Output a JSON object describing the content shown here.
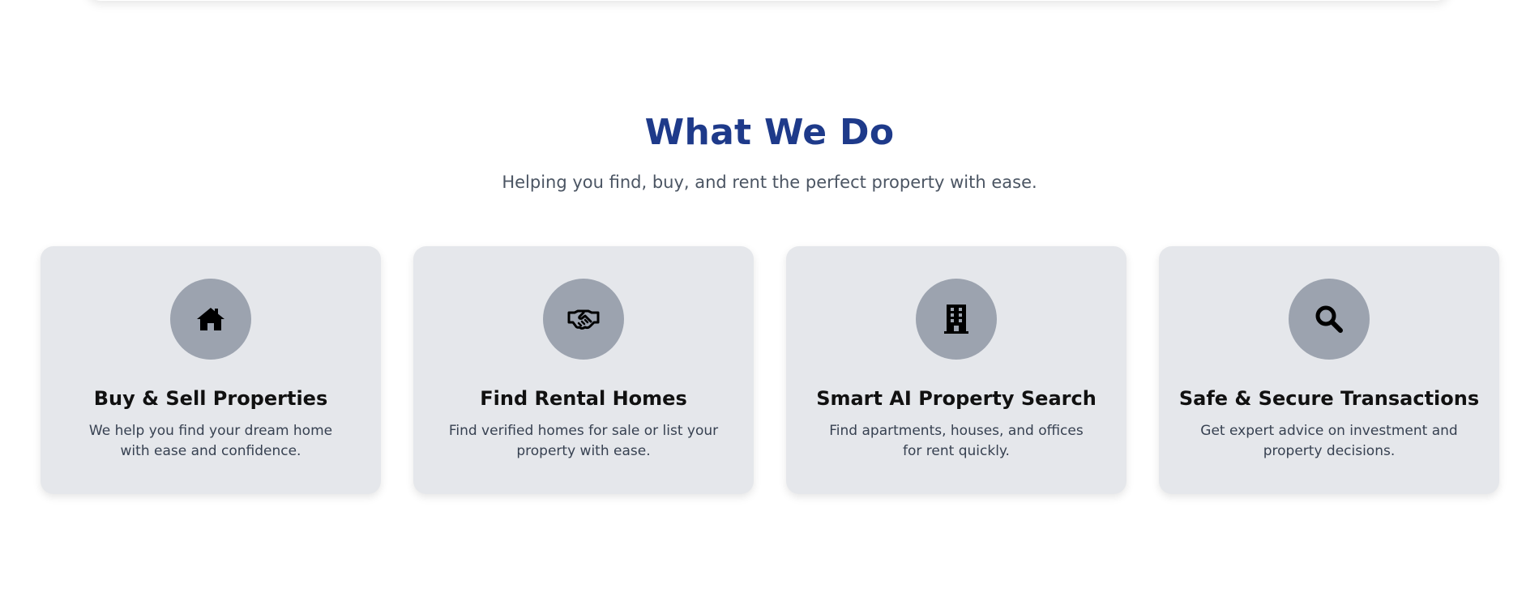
{
  "section": {
    "title": "What We Do",
    "subtitle": "Helping you find, buy, and rent the perfect property with ease."
  },
  "cards": [
    {
      "icon": "home-icon",
      "title": "Buy & Sell Properties",
      "description": "We help you find your dream home with ease and confidence."
    },
    {
      "icon": "handshake-icon",
      "title": "Find Rental Homes",
      "description": "Find verified homes for sale or list your property with ease."
    },
    {
      "icon": "building-icon",
      "title": "Smart AI Property Search",
      "description": "Find apartments, houses, and offices for rent quickly."
    },
    {
      "icon": "search-icon",
      "title": "Safe & Secure Transactions",
      "description": "Get expert advice on investment and property decisions."
    }
  ],
  "colors": {
    "heading": "#1e3a8a",
    "card_background": "#e5e7eb",
    "icon_circle": "#9ca3af"
  }
}
